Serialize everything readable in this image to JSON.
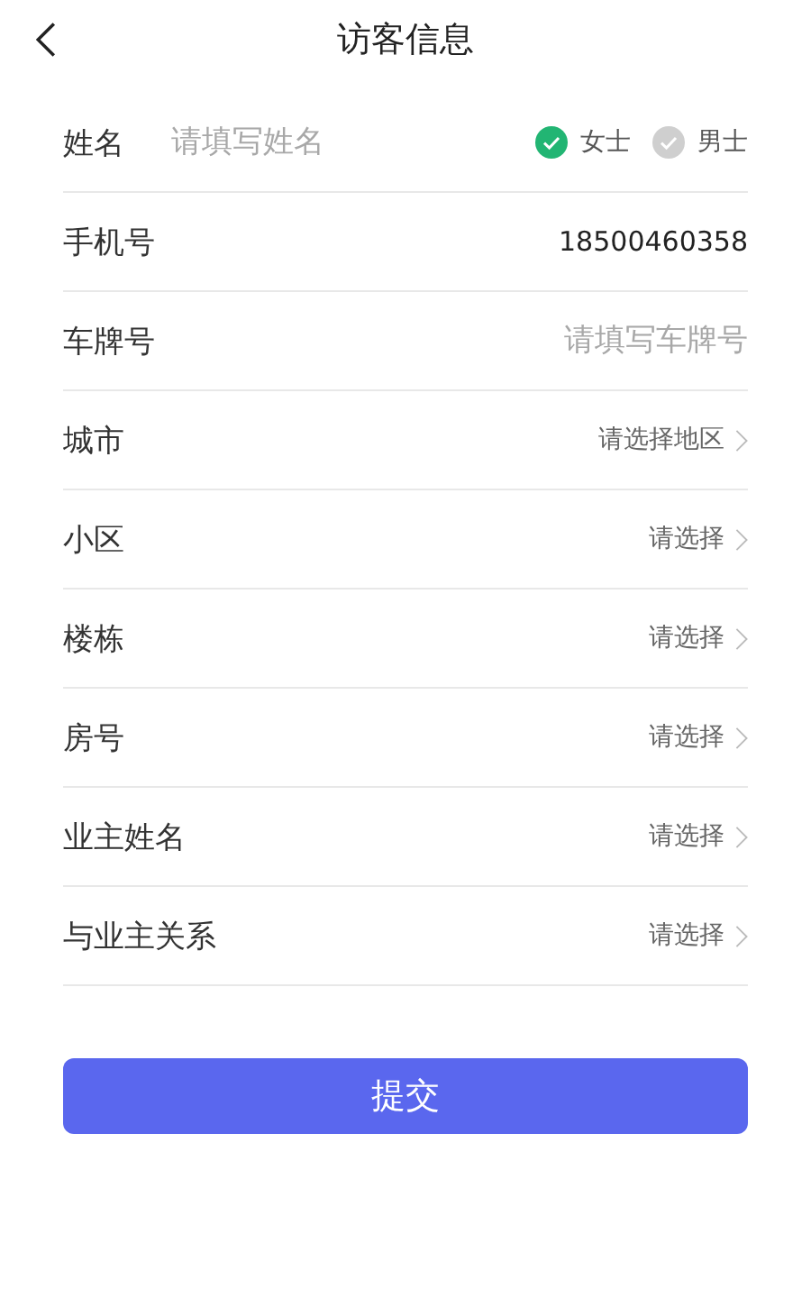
{
  "header": {
    "title": "访客信息"
  },
  "rows": [
    {
      "kind": "name",
      "label": "姓名",
      "placeholder": "请填写姓名",
      "options": [
        {
          "label": "女士",
          "selected": true
        },
        {
          "label": "男士",
          "selected": false
        }
      ]
    },
    {
      "kind": "value",
      "label": "手机号",
      "value": "18500460358"
    },
    {
      "kind": "input",
      "label": "车牌号",
      "placeholder": "请填写车牌号"
    },
    {
      "kind": "select",
      "label": "城市",
      "placeholder": "请选择地区"
    },
    {
      "kind": "select",
      "label": "小区",
      "placeholder": "请选择"
    },
    {
      "kind": "select",
      "label": "楼栋",
      "placeholder": "请选择"
    },
    {
      "kind": "select",
      "label": "房号",
      "placeholder": "请选择"
    },
    {
      "kind": "select",
      "label": "业主姓名",
      "placeholder": "请选择"
    },
    {
      "kind": "select",
      "label": "与业主关系",
      "placeholder": "请选择"
    }
  ],
  "submit": {
    "label": "提交"
  }
}
